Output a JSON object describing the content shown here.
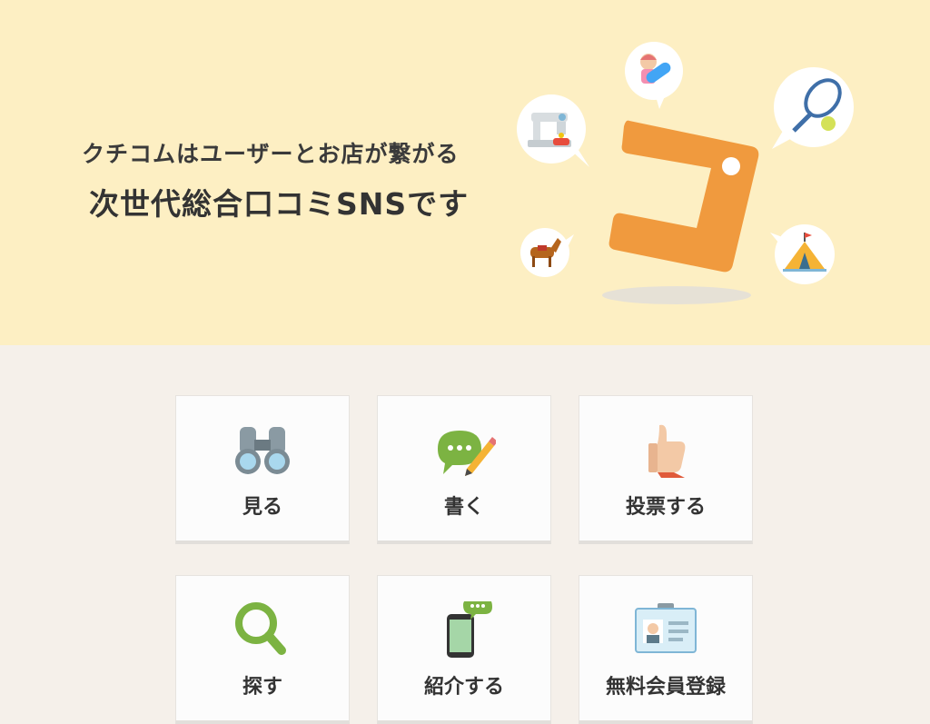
{
  "hero": {
    "tagline_line1": "クチコムはユーザーとお店が繋がる",
    "tagline_line2": "次世代総合口コミSNSです",
    "logo_icon": "kuchikomu-logo-icon",
    "bubble_icons": [
      "sewing-machine-icon",
      "snowboarder-icon",
      "tennis-racket-icon",
      "horse-icon",
      "tent-icon"
    ]
  },
  "menu": {
    "items": [
      {
        "label": "見る",
        "icon": "binoculars-icon"
      },
      {
        "label": "書く",
        "icon": "speech-pencil-icon"
      },
      {
        "label": "投票する",
        "icon": "thumbs-up-icon"
      },
      {
        "label": "探す",
        "icon": "magnifier-icon"
      },
      {
        "label": "紹介する",
        "icon": "smartphone-chat-icon"
      },
      {
        "label": "無料会員登録",
        "icon": "id-card-icon"
      }
    ]
  },
  "colors": {
    "hero_bg": "#fdefc3",
    "page_bg": "#f5f0ea",
    "logo_orange": "#f09a3e",
    "green": "#7cb342"
  }
}
